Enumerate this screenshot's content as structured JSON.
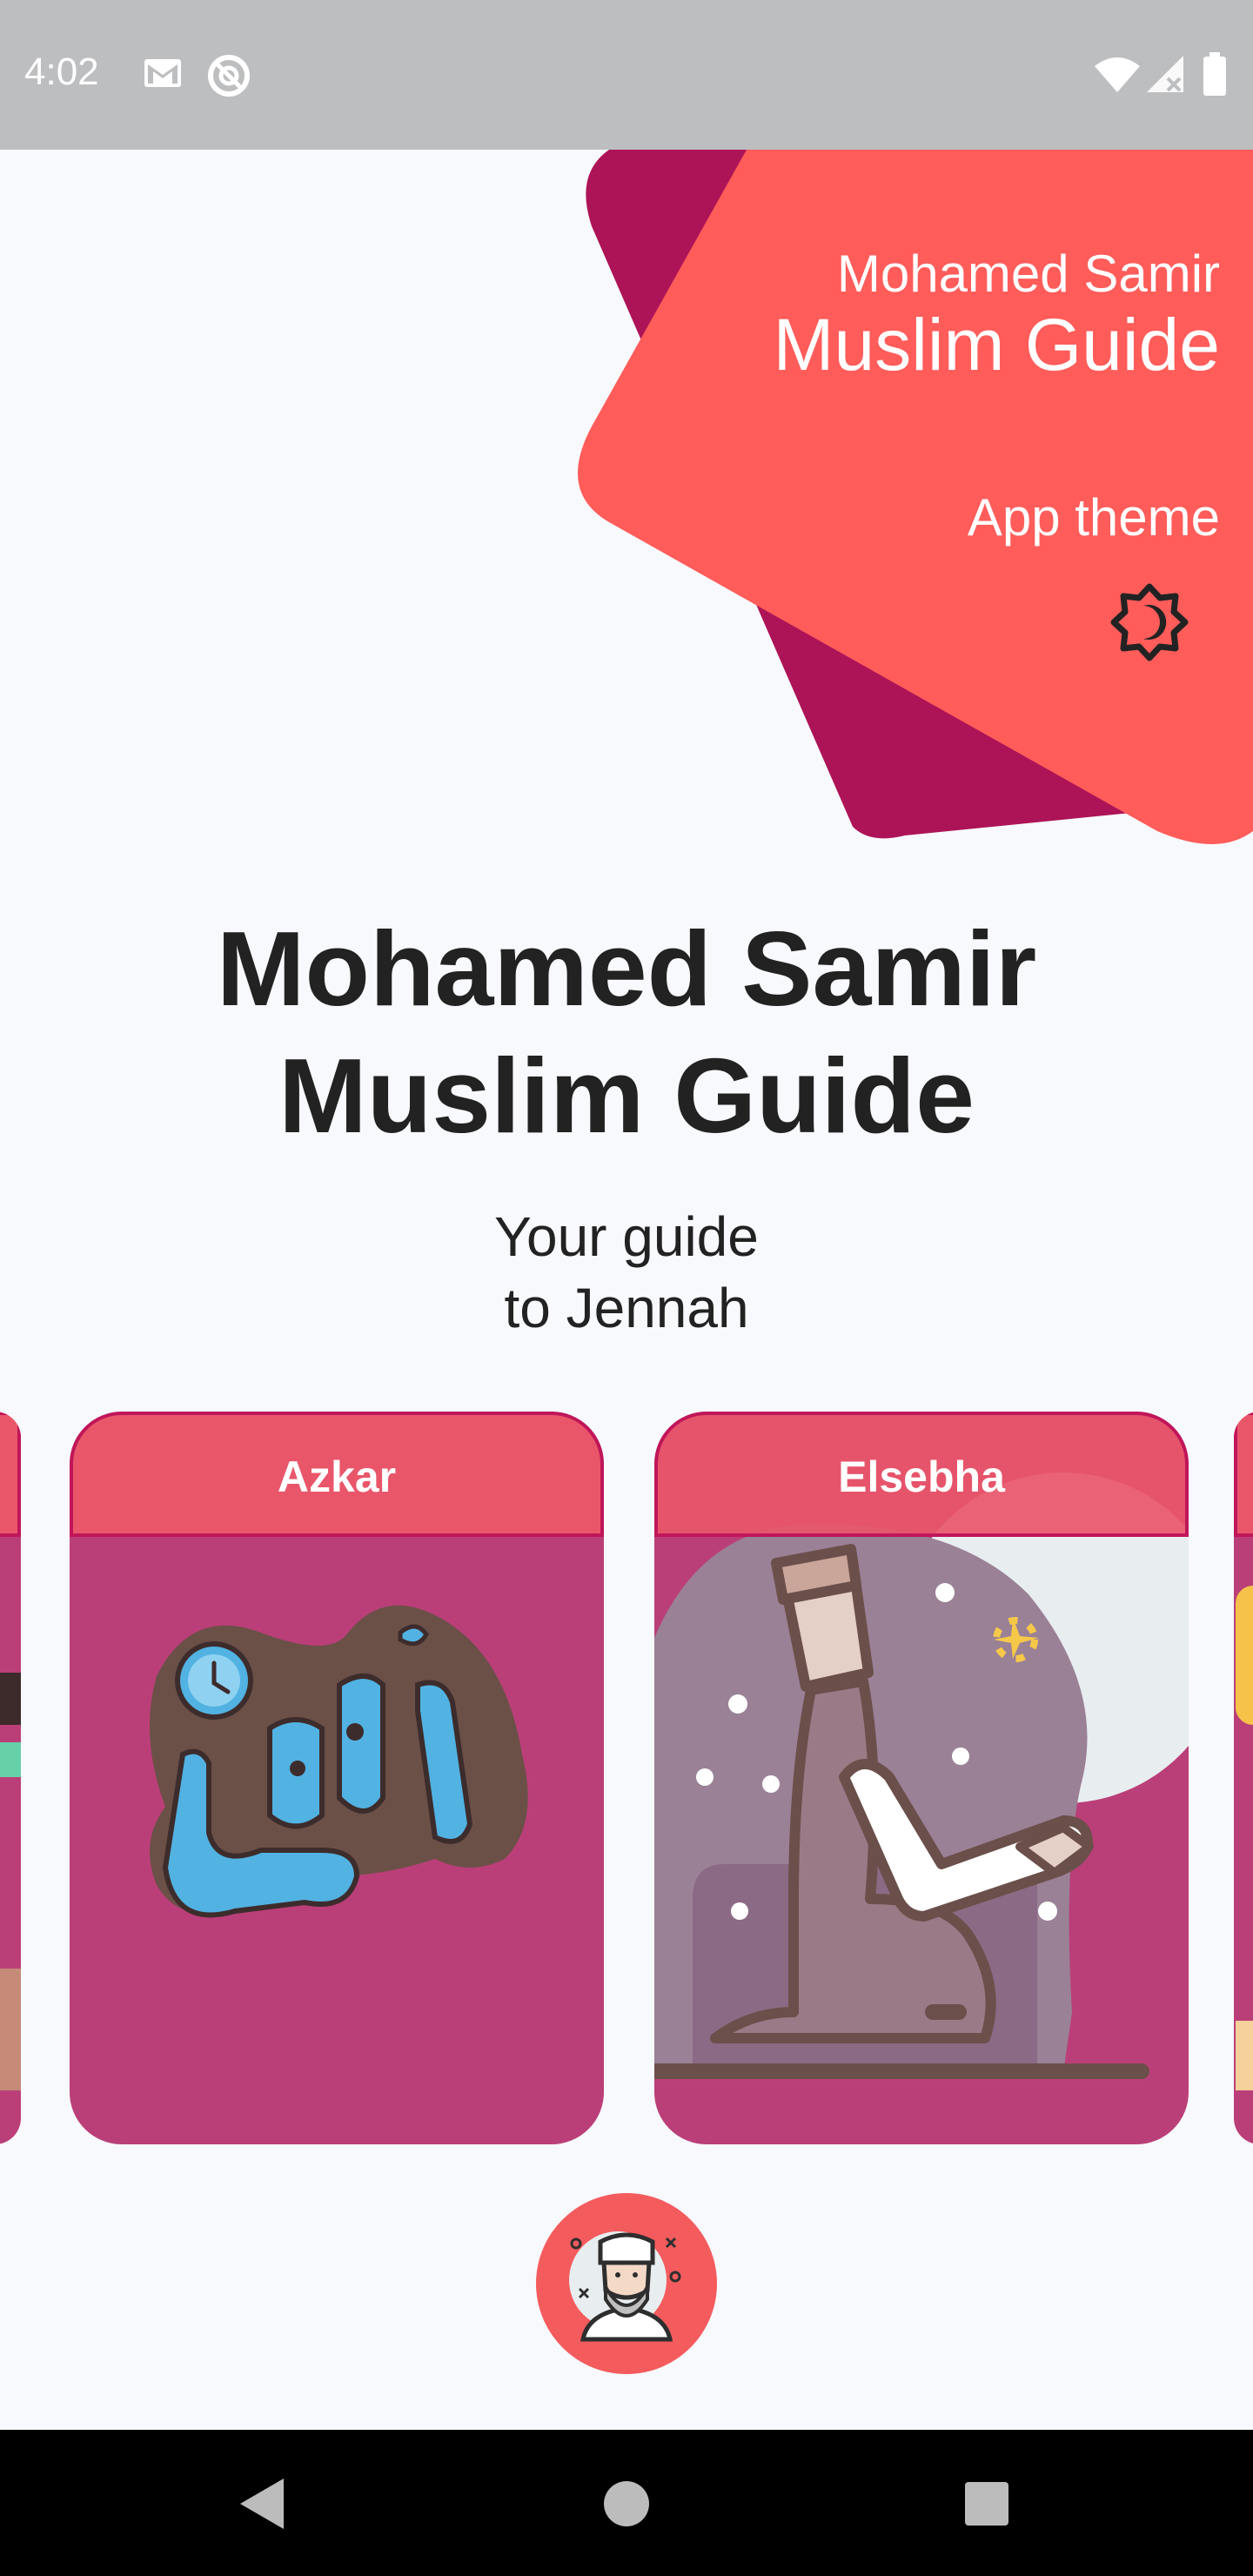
{
  "status_bar": {
    "time": "4:02",
    "left_icons": [
      "gmail-icon",
      "no-disturb-icon"
    ],
    "right_icons": [
      "wifi-icon",
      "signal-icon",
      "battery-icon"
    ]
  },
  "header": {
    "subtitle": "Mohamed Samir",
    "title": "Muslim Guide",
    "theme_label": "App theme",
    "theme_icon": "brightness-icon",
    "colors": {
      "back_card": "#ad1457",
      "front_card": "#ff5c5a"
    }
  },
  "main": {
    "title_line1": "Mohamed Samir",
    "title_line2": "Muslim Guide",
    "tagline_line1": "Your guide",
    "tagline_line2": "to Jennah"
  },
  "carousel": {
    "cards": [
      {
        "title": "Azkar",
        "icon": "azkar-calligraphy-icon"
      },
      {
        "title": "Elsebha",
        "icon": "praying-man-icon"
      }
    ],
    "colors": {
      "card_body": "#ba3f78",
      "card_header": "#e9566a",
      "card_border": "#c0165a"
    }
  },
  "fab": {
    "icon": "sheikh-avatar-icon",
    "color": "#f45b5d"
  },
  "nav_bar": {
    "buttons": [
      "back-icon",
      "home-icon",
      "recents-icon"
    ]
  }
}
